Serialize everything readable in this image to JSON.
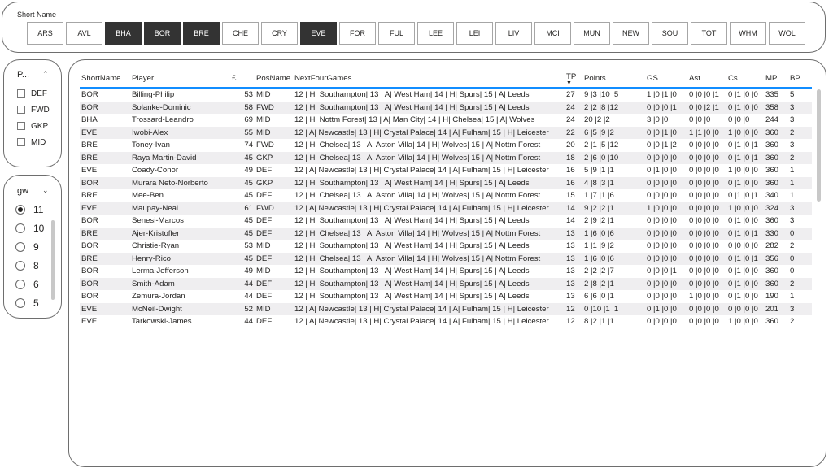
{
  "team_slicer": {
    "title": "Short Name",
    "teams": [
      {
        "label": "ARS",
        "selected": false
      },
      {
        "label": "AVL",
        "selected": false
      },
      {
        "label": "BHA",
        "selected": true
      },
      {
        "label": "BOR",
        "selected": true
      },
      {
        "label": "BRE",
        "selected": true
      },
      {
        "label": "CHE",
        "selected": false
      },
      {
        "label": "CRY",
        "selected": false
      },
      {
        "label": "EVE",
        "selected": true
      },
      {
        "label": "FOR",
        "selected": false
      },
      {
        "label": "FUL",
        "selected": false
      },
      {
        "label": "LEE",
        "selected": false
      },
      {
        "label": "LEI",
        "selected": false
      },
      {
        "label": "LIV",
        "selected": false
      },
      {
        "label": "MCI",
        "selected": false
      },
      {
        "label": "MUN",
        "selected": false
      },
      {
        "label": "NEW",
        "selected": false
      },
      {
        "label": "SOU",
        "selected": false
      },
      {
        "label": "TOT",
        "selected": false
      },
      {
        "label": "WHM",
        "selected": false
      },
      {
        "label": "WOL",
        "selected": false
      }
    ]
  },
  "pos_slicer": {
    "title": "P...",
    "items": [
      "DEF",
      "FWD",
      "GKP",
      "MID"
    ]
  },
  "gw_slicer": {
    "title": "gw",
    "items": [
      "11",
      "10",
      "9",
      "8",
      "6",
      "5"
    ],
    "selected": "11"
  },
  "table": {
    "headers": [
      "ShortName",
      "Player",
      "£",
      "PosName",
      "NextFourGames",
      "TP",
      "Points",
      "GS",
      "Ast",
      "Cs",
      "MP",
      "BP"
    ],
    "rows": [
      [
        "BOR",
        "Billing-Philip",
        "53",
        "MID",
        "12 | H| Southampton| 13 | A| West Ham| 14 | H| Spurs| 15 | A| Leeds",
        "27",
        "9 |3 |10 |5",
        "1 |0 |1 |0",
        "0 |0 |0 |1",
        "0 |1 |0 |0",
        "335",
        "5"
      ],
      [
        "BOR",
        "Solanke-Dominic",
        "58",
        "FWD",
        "12 | H| Southampton| 13 | A| West Ham| 14 | H| Spurs| 15 | A| Leeds",
        "24",
        "2 |2 |8 |12",
        "0 |0 |0 |1",
        "0 |0 |2 |1",
        "0 |1 |0 |0",
        "358",
        "3"
      ],
      [
        "BHA",
        "Trossard-Leandro",
        "69",
        "MID",
        "12 | H| Nottm Forest| 13 | A| Man City| 14 | H| Chelsea| 15 | A| Wolves",
        "24",
        "20 |2 |2",
        "3 |0 |0",
        "0 |0 |0",
        "0 |0 |0",
        "244",
        "3"
      ],
      [
        "EVE",
        "Iwobi-Alex",
        "55",
        "MID",
        "12 | A| Newcastle| 13 | H| Crystal Palace| 14 | A| Fulham| 15 | H| Leicester",
        "22",
        "6 |5 |9 |2",
        "0 |0 |1 |0",
        "1 |1 |0 |0",
        "1 |0 |0 |0",
        "360",
        "2"
      ],
      [
        "BRE",
        "Toney-Ivan",
        "74",
        "FWD",
        "12 | H| Chelsea| 13 | A| Aston Villa| 14 | H| Wolves| 15 | A| Nottm Forest",
        "20",
        "2 |1 |5 |12",
        "0 |0 |1 |2",
        "0 |0 |0 |0",
        "0 |1 |0 |1",
        "360",
        "3"
      ],
      [
        "BRE",
        "Raya Martin-David",
        "45",
        "GKP",
        "12 | H| Chelsea| 13 | A| Aston Villa| 14 | H| Wolves| 15 | A| Nottm Forest",
        "18",
        "2 |6 |0 |10",
        "0 |0 |0 |0",
        "0 |0 |0 |0",
        "0 |1 |0 |1",
        "360",
        "2"
      ],
      [
        "EVE",
        "Coady-Conor",
        "49",
        "DEF",
        "12 | A| Newcastle| 13 | H| Crystal Palace| 14 | A| Fulham| 15 | H| Leicester",
        "16",
        "5 |9 |1 |1",
        "0 |1 |0 |0",
        "0 |0 |0 |0",
        "1 |0 |0 |0",
        "360",
        "1"
      ],
      [
        "BOR",
        "Murara Neto-Norberto",
        "45",
        "GKP",
        "12 | H| Southampton| 13 | A| West Ham| 14 | H| Spurs| 15 | A| Leeds",
        "16",
        "4 |8 |3 |1",
        "0 |0 |0 |0",
        "0 |0 |0 |0",
        "0 |1 |0 |0",
        "360",
        "1"
      ],
      [
        "BRE",
        "Mee-Ben",
        "45",
        "DEF",
        "12 | H| Chelsea| 13 | A| Aston Villa| 14 | H| Wolves| 15 | A| Nottm Forest",
        "15",
        "1 |7 |1 |6",
        "0 |0 |0 |0",
        "0 |0 |0 |0",
        "0 |1 |0 |1",
        "340",
        "1"
      ],
      [
        "EVE",
        "Maupay-Neal",
        "61",
        "FWD",
        "12 | A| Newcastle| 13 | H| Crystal Palace| 14 | A| Fulham| 15 | H| Leicester",
        "14",
        "9 |2 |2 |1",
        "1 |0 |0 |0",
        "0 |0 |0 |0",
        "1 |0 |0 |0",
        "324",
        "3"
      ],
      [
        "BOR",
        "Senesi-Marcos",
        "45",
        "DEF",
        "12 | H| Southampton| 13 | A| West Ham| 14 | H| Spurs| 15 | A| Leeds",
        "14",
        "2 |9 |2 |1",
        "0 |0 |0 |0",
        "0 |0 |0 |0",
        "0 |1 |0 |0",
        "360",
        "3"
      ],
      [
        "BRE",
        "Ajer-Kristoffer",
        "45",
        "DEF",
        "12 | H| Chelsea| 13 | A| Aston Villa| 14 | H| Wolves| 15 | A| Nottm Forest",
        "13",
        "1 |6 |0 |6",
        "0 |0 |0 |0",
        "0 |0 |0 |0",
        "0 |1 |0 |1",
        "330",
        "0"
      ],
      [
        "BOR",
        "Christie-Ryan",
        "53",
        "MID",
        "12 | H| Southampton| 13 | A| West Ham| 14 | H| Spurs| 15 | A| Leeds",
        "13",
        "1 |1 |9 |2",
        "0 |0 |0 |0",
        "0 |0 |0 |0",
        "0 |0 |0 |0",
        "282",
        "2"
      ],
      [
        "BRE",
        "Henry-Rico",
        "45",
        "DEF",
        "12 | H| Chelsea| 13 | A| Aston Villa| 14 | H| Wolves| 15 | A| Nottm Forest",
        "13",
        "1 |6 |0 |6",
        "0 |0 |0 |0",
        "0 |0 |0 |0",
        "0 |1 |0 |1",
        "356",
        "0"
      ],
      [
        "BOR",
        "Lerma-Jefferson",
        "49",
        "MID",
        "12 | H| Southampton| 13 | A| West Ham| 14 | H| Spurs| 15 | A| Leeds",
        "13",
        "2 |2 |2 |7",
        "0 |0 |0 |1",
        "0 |0 |0 |0",
        "0 |1 |0 |0",
        "360",
        "0"
      ],
      [
        "BOR",
        "Smith-Adam",
        "44",
        "DEF",
        "12 | H| Southampton| 13 | A| West Ham| 14 | H| Spurs| 15 | A| Leeds",
        "13",
        "2 |8 |2 |1",
        "0 |0 |0 |0",
        "0 |0 |0 |0",
        "0 |1 |0 |0",
        "360",
        "2"
      ],
      [
        "BOR",
        "Zemura-Jordan",
        "44",
        "DEF",
        "12 | H| Southampton| 13 | A| West Ham| 14 | H| Spurs| 15 | A| Leeds",
        "13",
        "6 |6 |0 |1",
        "0 |0 |0 |0",
        "1 |0 |0 |0",
        "0 |1 |0 |0",
        "190",
        "1"
      ],
      [
        "EVE",
        "McNeil-Dwight",
        "52",
        "MID",
        "12 | A| Newcastle| 13 | H| Crystal Palace| 14 | A| Fulham| 15 | H| Leicester",
        "12",
        "0 |10 |1 |1",
        "0 |1 |0 |0",
        "0 |0 |0 |0",
        "0 |0 |0 |0",
        "201",
        "3"
      ],
      [
        "EVE",
        "Tarkowski-James",
        "44",
        "DEF",
        "12 | A| Newcastle| 13 | H| Crystal Palace| 14 | A| Fulham| 15 | H| Leicester",
        "12",
        "8 |2 |1 |1",
        "0 |0 |0 |0",
        "0 |0 |0 |0",
        "1 |0 |0 |0",
        "360",
        "2"
      ]
    ]
  }
}
